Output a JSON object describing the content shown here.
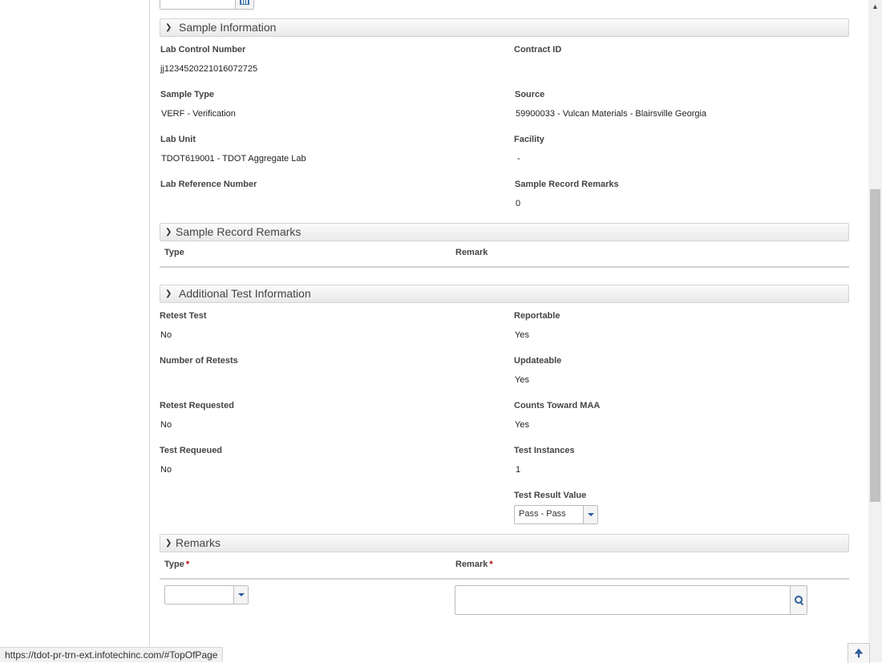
{
  "sections": {
    "sample_info": {
      "title": "Sample Information"
    },
    "record_remarks": {
      "title": "Sample Record Remarks",
      "columns": [
        "Type",
        "Remark"
      ]
    },
    "additional": {
      "title": "Additional Test Information"
    },
    "remarks": {
      "title": "Remarks",
      "columns": [
        "Type",
        "Remark"
      ],
      "required_mark": "*"
    }
  },
  "sample_info": {
    "lab_control_number": {
      "label": "Lab Control Number",
      "value": "jj1234520221016072725"
    },
    "contract_id": {
      "label": "Contract ID",
      "value": ""
    },
    "sample_type": {
      "label": "Sample Type",
      "value": "VERF - Verification"
    },
    "source": {
      "label": "Source",
      "value": "59900033 - Vulcan Materials - Blairsville Georgia"
    },
    "lab_unit": {
      "label": "Lab Unit",
      "value": "TDOT619001 - TDOT Aggregate Lab"
    },
    "facility": {
      "label": "Facility",
      "value": "-"
    },
    "lab_reference_number": {
      "label": "Lab Reference Number",
      "value": ""
    },
    "sample_record_remarks": {
      "label": "Sample Record Remarks",
      "value": "0"
    }
  },
  "additional": {
    "retest_test": {
      "label": "Retest Test",
      "value": "No"
    },
    "reportable": {
      "label": "Reportable",
      "value": "Yes"
    },
    "number_of_retests": {
      "label": "Number of Retests",
      "value": ""
    },
    "updateable": {
      "label": "Updateable",
      "value": "Yes"
    },
    "retest_requested": {
      "label": "Retest Requested",
      "value": "No"
    },
    "counts_toward_maa": {
      "label": "Counts Toward MAA",
      "value": "Yes"
    },
    "test_requeued": {
      "label": "Test Requeued",
      "value": "No"
    },
    "test_instances": {
      "label": "Test Instances",
      "value": "1"
    },
    "test_result_value": {
      "label": "Test Result Value",
      "value": "Pass - Pass"
    }
  },
  "remarks_form": {
    "type_value": "",
    "remark_value": ""
  },
  "status_bar": {
    "url": "https://tdot-pr-trn-ext.infotechinc.com/#TopOfPage"
  },
  "icons": {
    "calendar": "calendar-icon",
    "chevron": "chevron-down-icon",
    "search": "zoom-icon",
    "to_top": "arrow-up-icon"
  },
  "colors": {
    "accent": "#2d5c9a",
    "required": "#b20000"
  }
}
